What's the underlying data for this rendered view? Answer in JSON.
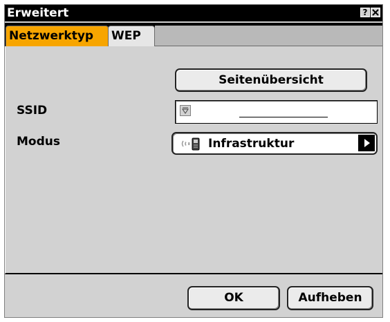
{
  "window": {
    "title": "Erweitert",
    "help_icon": "help-icon",
    "close_icon": "close-icon"
  },
  "tabs": [
    {
      "label": "Netzwerktyp",
      "active": true
    },
    {
      "label": "WEP",
      "active": false
    }
  ],
  "site_survey_button": "Seitenübersicht",
  "ssid": {
    "label": "SSID",
    "value": ""
  },
  "mode": {
    "label": "Modus",
    "value": "Infrastruktur",
    "icon": "wireless-signal-icon"
  },
  "buttons": {
    "ok": "OK",
    "cancel": "Aufheben"
  },
  "colors": {
    "active_tab": "#f7a500",
    "title_bar": "#000000",
    "panel": "#d2d2d2"
  }
}
